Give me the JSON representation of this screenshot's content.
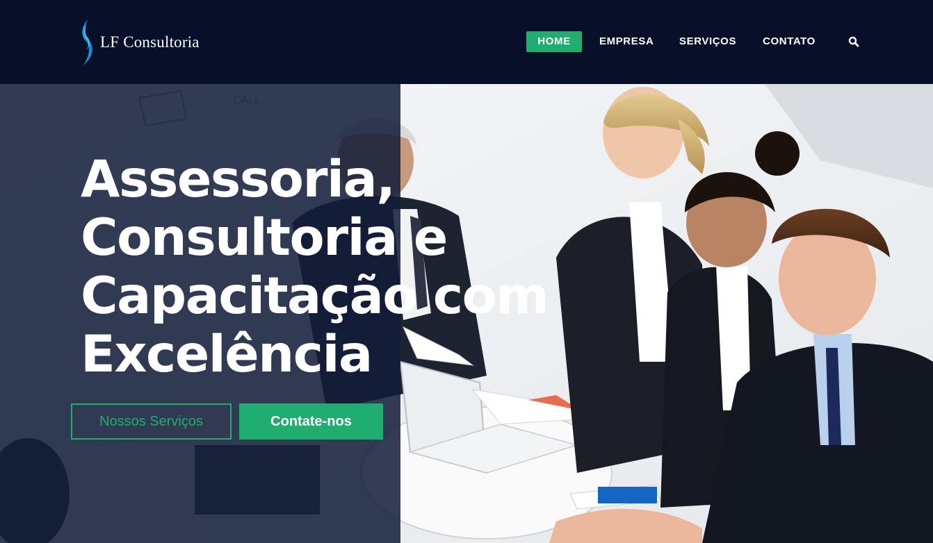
{
  "brand": {
    "name": "LF Consultoria",
    "logo_icon": "flame-s-logo-icon"
  },
  "nav": {
    "items": [
      {
        "label": "HOME",
        "active": true
      },
      {
        "label": "EMPRESA",
        "active": false
      },
      {
        "label": "SERVIÇOS",
        "active": false
      },
      {
        "label": "CONTATO",
        "active": false
      }
    ],
    "search_icon": "search-icon"
  },
  "hero": {
    "headline_lines": [
      "Assessoria,",
      "Consultoria e",
      "Capacitação com",
      "Excelência"
    ],
    "buttons": {
      "primary_outline": "Nossos Serviços",
      "primary_solid": "Contate-nos"
    },
    "background_image": "business-team-meeting-photo"
  },
  "colors": {
    "header_bg": "#081029",
    "accent": "#1fae6f",
    "overlay": "#121c38",
    "text": "#ffffff"
  }
}
